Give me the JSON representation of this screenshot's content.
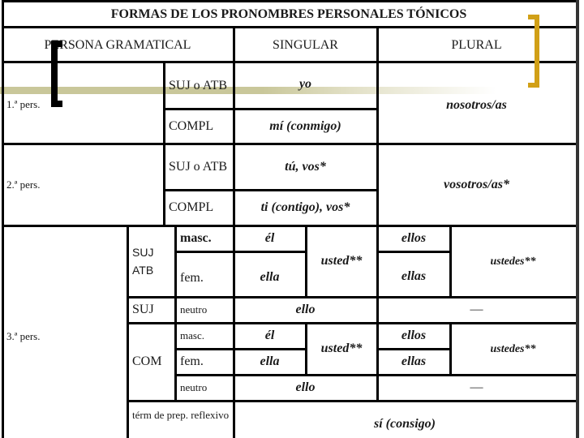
{
  "title": "FORMAS DE LOS PRONOMBRES PERSONALES TÓNICOS",
  "headers": {
    "persona": "PERSONA GRAMATICAL",
    "singular": "SINGULAR",
    "plural": "PLURAL"
  },
  "first_person": {
    "label": "1.ª pers.",
    "suj_atb": "SUJ o ATB",
    "compl": "COMPL",
    "sing_suj": "yo",
    "sing_compl": "mí (conmigo)",
    "plural": "nosotros/as"
  },
  "second_person": {
    "label": "2.ª pers.",
    "suj_atb": "SUJ o ATB",
    "compl": "COMPL",
    "sing_suj": "tú, vos*",
    "sing_compl": "ti (contigo), vos*",
    "plural": "vosotros/as*"
  },
  "third_person": {
    "label": "3.ª pers.",
    "suj_atb_group": {
      "label": "SUJ ATB",
      "masc": "masc.",
      "fem": "fem.",
      "sing_masc": "él",
      "sing_fem": "ella",
      "usted": "usted**",
      "plural_masc": "ellos",
      "plural_fem": "ellas",
      "ustedes": "ustedes**"
    },
    "suj_group": {
      "label": "SUJ",
      "neutro": "neutro",
      "sing": "ello",
      "plural": "—"
    },
    "com_group": {
      "label": "COM",
      "masc": "masc.",
      "fem": "fem.",
      "neutro": "neutro",
      "sing_masc": "él",
      "sing_fem": "ella",
      "usted": "usted**",
      "plural_masc": "ellos",
      "plural_fem": "ellas",
      "ustedes": "ustedes**",
      "sing_neutro": "ello",
      "plural_neutro": "—"
    },
    "reflexive": {
      "label": "térm de prep. reflexivo",
      "value": "sí (consigo)"
    }
  },
  "colors": {
    "bracket_gold": "#d1a017",
    "band_olive": "#c9c79a",
    "line": "#000000"
  }
}
